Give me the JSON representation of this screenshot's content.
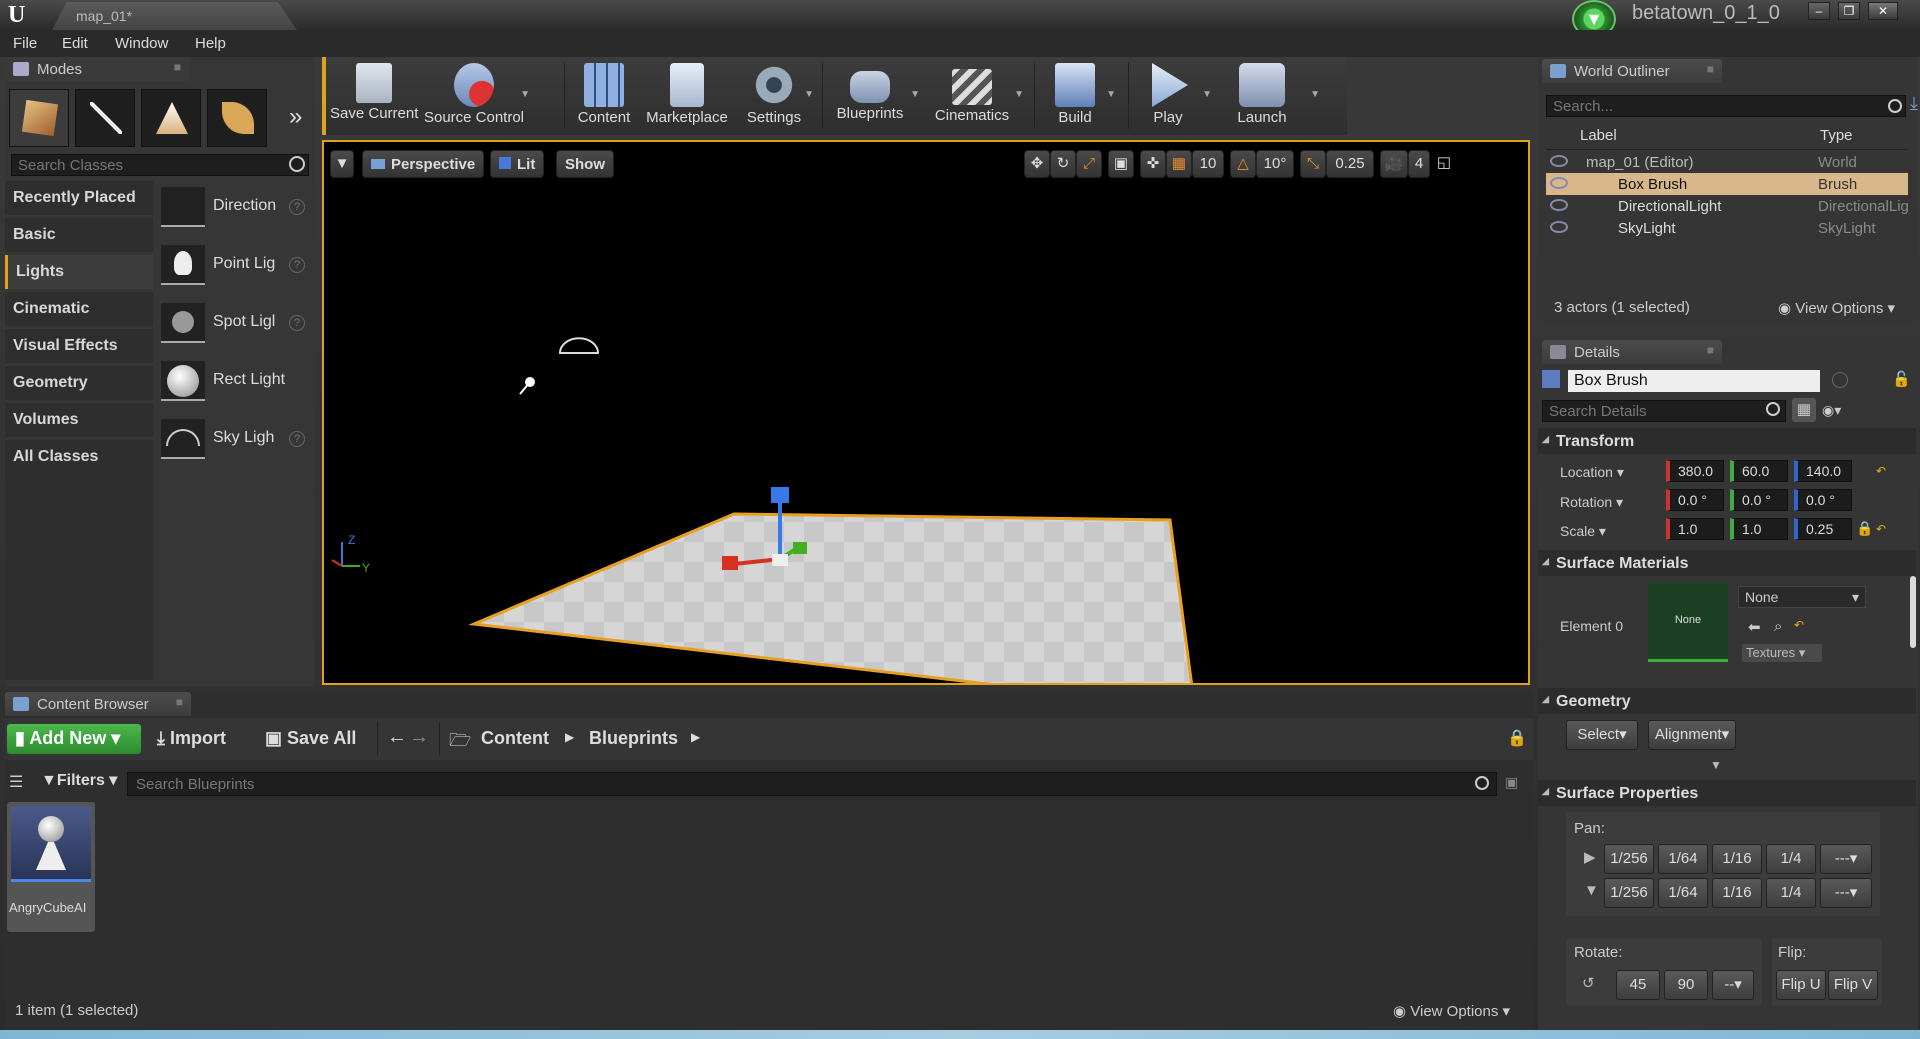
{
  "window": {
    "doc_tab": "map_01*",
    "project_name": "betatown_0_1_0"
  },
  "menu": [
    "File",
    "Edit",
    "Window",
    "Help"
  ],
  "modes": {
    "title": "Modes",
    "search_placeholder": "Search Classes",
    "categories": [
      "Recently Placed",
      "Basic",
      "Lights",
      "Cinematic",
      "Visual Effects",
      "Geometry",
      "Volumes",
      "All Classes"
    ],
    "selected_category": "Lights",
    "items": [
      "Direction",
      "Point Lig",
      "Spot Ligl",
      "Rect Light",
      "Sky Ligh"
    ]
  },
  "toolbar": {
    "buttons": [
      "Save Current",
      "Source Control",
      "Content",
      "Marketplace",
      "Settings",
      "Blueprints",
      "Cinematics",
      "Build",
      "Play",
      "Launch"
    ]
  },
  "viewport": {
    "perspective": "Perspective",
    "lit": "Lit",
    "show": "Show",
    "grid_snap": "10",
    "rot_snap": "10°",
    "scale_snap": "0.25",
    "cam_speed": "4",
    "axis_z": "Z",
    "axis_y": "Y"
  },
  "outliner": {
    "title": "World Outliner",
    "search_placeholder": "Search...",
    "col_label": "Label",
    "col_type": "Type",
    "rows": [
      {
        "label": "map_01 (Editor)",
        "type": "World"
      },
      {
        "label": "Box Brush",
        "type": "Brush"
      },
      {
        "label": "DirectionalLight",
        "type": "DirectionalLig"
      },
      {
        "label": "SkyLight",
        "type": "SkyLight"
      }
    ],
    "status": "3 actors (1 selected)",
    "view_options": "View Options"
  },
  "details": {
    "title": "Details",
    "object_name": "Box Brush",
    "search_placeholder": "Search Details",
    "transform": {
      "title": "Transform",
      "location_label": "Location",
      "rotation_label": "Rotation",
      "scale_label": "Scale",
      "location": [
        "380.0",
        "60.0",
        "140.0"
      ],
      "rotation": [
        "0.0 °",
        "0.0 °",
        "0.0 °"
      ],
      "scale": [
        "1.0",
        "1.0",
        "0.25"
      ]
    },
    "surface_materials": {
      "title": "Surface Materials",
      "element": "Element 0",
      "thumb": "None",
      "material": "None",
      "textures": "Textures"
    },
    "geometry": {
      "title": "Geometry",
      "select": "Select",
      "alignment": "Alignment"
    },
    "surface_properties": {
      "title": "Surface Properties",
      "pan": "Pan:",
      "pan_values": [
        "1/256",
        "1/64",
        "1/16",
        "1/4",
        "---"
      ],
      "rotate": "Rotate:",
      "rotate_values": [
        "45",
        "90",
        "--"
      ],
      "flip": "Flip:",
      "flip_u": "Flip U",
      "flip_v": "Flip V"
    }
  },
  "content_browser": {
    "title": "Content Browser",
    "add_new": "Add New",
    "import": "Import",
    "save_all": "Save All",
    "path": [
      "Content",
      "Blueprints"
    ],
    "filters": "Filters",
    "search_placeholder": "Search Blueprints",
    "asset": "AngryCubeAI",
    "status": "1 item (1 selected)",
    "view_options": "View Options"
  }
}
